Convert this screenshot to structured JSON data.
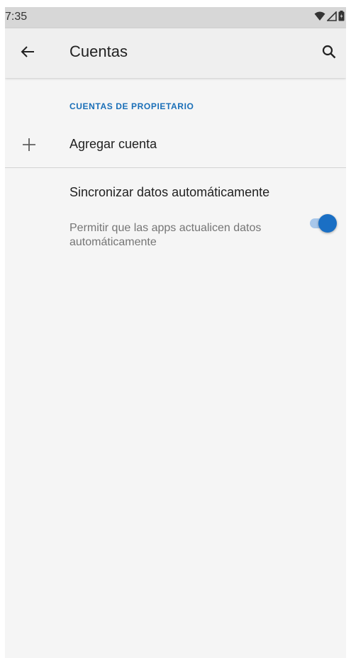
{
  "status_bar": {
    "time": "7:35",
    "icons": [
      "wifi-icon",
      "signal-icon",
      "battery-icon"
    ]
  },
  "app_bar": {
    "title": "Cuentas",
    "back_icon": "arrow-back-icon",
    "search_icon": "search-icon"
  },
  "section": {
    "header": "CUENTAS DE PROPIETARIO"
  },
  "add_account": {
    "icon": "plus-icon",
    "label": "Agregar cuenta"
  },
  "sync": {
    "title": "Sincronizar datos automáticamente",
    "summary": "Permitir que las apps actualicen datos automáticamente",
    "enabled": true
  },
  "colors": {
    "accent": "#1a6fc4",
    "section_header": "#1a6fb8",
    "toggle_track": "#a8c7ea",
    "app_bar_bg": "#efefef",
    "page_bg": "#f5f5f5",
    "status_bar_bg": "#d7d7d7"
  }
}
